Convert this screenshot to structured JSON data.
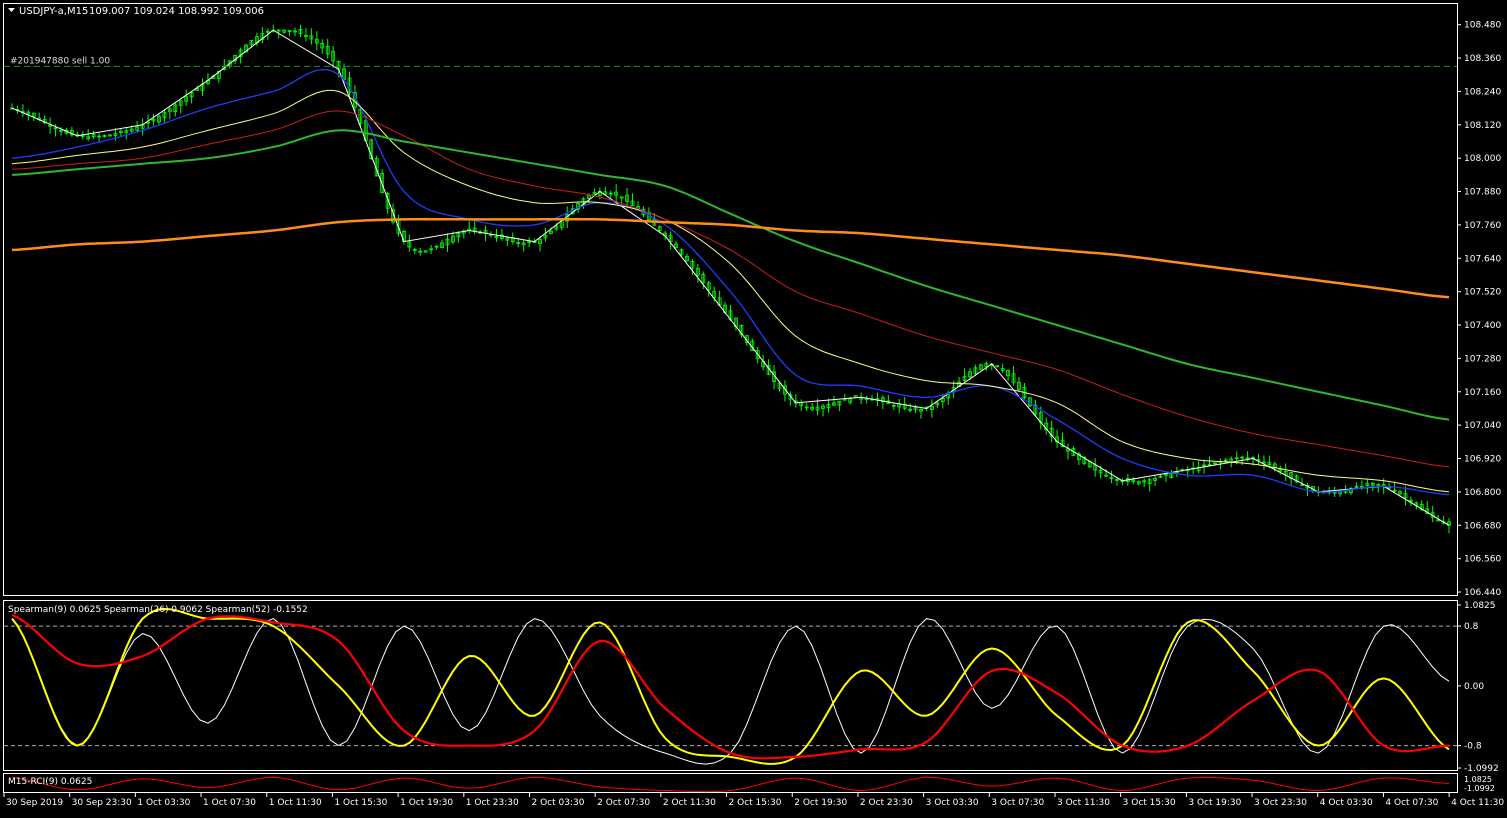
{
  "colors": {
    "background": "#000000",
    "frame": "#ffffff",
    "candle": "#00ff00",
    "zigzag": "#ffffff",
    "ma_blue": "#1e3cff",
    "ma_yellow": "#ffff80",
    "ma_red": "#c81e1e",
    "ma_green": "#2db82d",
    "ma_orange": "#ff8c1a",
    "order_line": "#2e8b2e",
    "spearman_fast": "#ffffff",
    "spearman_mid": "#ffff00",
    "spearman_slow": "#ff0000",
    "rci": "#ff0000"
  },
  "main": {
    "header": {
      "menu_icon": "triangle-down-icon",
      "symbol": "USDJPY-a,M15",
      "ohlc": "109.007 109.024 108.992 109.006"
    },
    "order_label": "#201947880 sell 1.00",
    "order_price": 108.33,
    "price_axis": [
      "108.480",
      "108.360",
      "108.240",
      "108.120",
      "108.000",
      "107.880",
      "107.760",
      "107.640",
      "107.520",
      "107.400",
      "107.280",
      "107.160",
      "107.040",
      "106.920",
      "106.800",
      "106.680",
      "106.560",
      "106.440"
    ]
  },
  "osc": {
    "label": "Spearman(9) 0.0625  Spearman(26) 0.9062  Spearman(52) -0.1552",
    "axis": [
      "1.0825",
      "0.8",
      "0.00",
      "-0.8",
      "-1.0992"
    ]
  },
  "rci": {
    "label": "M15-RCI(9) 0.0625",
    "axis": [
      "1.0825",
      "-1.0992"
    ]
  },
  "time_axis": [
    "30 Sep 2019",
    "30 Sep 23:30",
    "1 Oct 03:30",
    "1 Oct 07:30",
    "1 Oct 11:30",
    "1 Oct 15:30",
    "1 Oct 19:30",
    "1 Oct 23:30",
    "2 Oct 03:30",
    "2 Oct 07:30",
    "2 Oct 11:30",
    "2 Oct 15:30",
    "2 Oct 19:30",
    "2 Oct 23:30",
    "3 Oct 03:30",
    "3 Oct 07:30",
    "3 Oct 11:30",
    "3 Oct 15:30",
    "3 Oct 19:30",
    "3 Oct 23:30",
    "4 Oct 03:30",
    "4 Oct 07:30",
    "4 Oct 11:30"
  ],
  "chart_data": [
    {
      "type": "line",
      "title": "USDJPY-a,M15",
      "ylim": [
        106.44,
        108.54
      ],
      "x": [
        "30 Sep 2019",
        "30 Sep 23:30",
        "1 Oct 03:30",
        "1 Oct 07:30",
        "1 Oct 11:30",
        "1 Oct 15:30",
        "1 Oct 19:30",
        "1 Oct 23:30",
        "2 Oct 03:30",
        "2 Oct 07:30",
        "2 Oct 11:30",
        "2 Oct 15:30",
        "2 Oct 19:30",
        "2 Oct 23:30",
        "3 Oct 03:30",
        "3 Oct 07:30",
        "3 Oct 11:30",
        "3 Oct 15:30",
        "3 Oct 19:30",
        "3 Oct 23:30",
        "4 Oct 03:30",
        "4 Oct 07:30",
        "4 Oct 11:30"
      ],
      "series": [
        {
          "values": [
            108.18,
            108.08,
            108.12,
            108.28,
            108.46,
            108.32,
            107.7,
            107.74,
            107.7,
            107.88,
            107.72,
            107.42,
            107.12,
            107.14,
            107.1,
            107.26,
            106.98,
            106.84,
            106.88,
            106.92,
            106.8,
            106.82,
            106.68
          ]
        },
        {
          "values": [
            108.0,
            108.04,
            108.1,
            108.18,
            108.24,
            108.3,
            107.88,
            107.78,
            107.76,
            107.84,
            107.76,
            107.52,
            107.22,
            107.18,
            107.14,
            107.18,
            107.06,
            106.92,
            106.86,
            106.86,
            106.8,
            106.82,
            106.79
          ]
        },
        {
          "values": [
            107.98,
            108.01,
            108.04,
            108.1,
            108.16,
            108.24,
            108.02,
            107.9,
            107.84,
            107.84,
            107.78,
            107.62,
            107.36,
            107.26,
            107.2,
            107.18,
            107.12,
            106.98,
            106.92,
            106.9,
            106.86,
            106.84,
            106.8
          ]
        },
        {
          "values": [
            107.96,
            107.98,
            108.0,
            108.05,
            108.1,
            108.17,
            108.08,
            107.96,
            107.9,
            107.86,
            107.78,
            107.67,
            107.52,
            107.44,
            107.36,
            107.3,
            107.24,
            107.15,
            107.07,
            107.01,
            106.97,
            106.93,
            106.89
          ]
        },
        {
          "values": [
            107.94,
            107.96,
            107.98,
            108.0,
            108.04,
            108.1,
            108.06,
            108.02,
            107.98,
            107.94,
            107.9,
            107.8,
            107.7,
            107.62,
            107.54,
            107.47,
            107.4,
            107.33,
            107.26,
            107.21,
            107.16,
            107.11,
            107.06
          ]
        },
        {
          "values": [
            107.67,
            107.69,
            107.7,
            107.72,
            107.74,
            107.77,
            107.78,
            107.78,
            107.78,
            107.78,
            107.77,
            107.76,
            107.74,
            107.73,
            107.71,
            107.69,
            107.67,
            107.65,
            107.62,
            107.59,
            107.56,
            107.53,
            107.5
          ]
        }
      ]
    },
    {
      "type": "line",
      "title": "Spearman(9) 0.0625  Spearman(26) 0.9062  Spearman(52) -0.1552",
      "ylim": [
        -1.0992,
        1.0825
      ],
      "x": [
        "30 Sep 2019",
        "30 Sep 23:30",
        "1 Oct 03:30",
        "1 Oct 07:30",
        "1 Oct 11:30",
        "1 Oct 15:30",
        "1 Oct 19:30",
        "1 Oct 23:30",
        "2 Oct 03:30",
        "2 Oct 07:30",
        "2 Oct 11:30",
        "2 Oct 15:30",
        "2 Oct 19:30",
        "2 Oct 23:30",
        "3 Oct 03:30",
        "3 Oct 07:30",
        "3 Oct 11:30",
        "3 Oct 15:30",
        "3 Oct 19:30",
        "3 Oct 23:30",
        "4 Oct 03:30",
        "4 Oct 07:30",
        "4 Oct 11:30"
      ],
      "series": [
        {
          "name": "Spearman(9)",
          "values": [
            0.9,
            -0.8,
            0.7,
            -0.5,
            0.9,
            -0.8,
            0.8,
            -0.6,
            0.9,
            -0.4,
            -0.9,
            -0.9,
            0.8,
            -0.9,
            0.9,
            -0.3,
            0.8,
            -0.9,
            0.8,
            0.5,
            -0.9,
            0.8,
            0.0625
          ]
        },
        {
          "name": "Spearman(26)",
          "values": [
            0.9,
            -0.8,
            0.9,
            0.9,
            0.8,
            0.0,
            -0.8,
            0.4,
            -0.4,
            0.85,
            -0.7,
            -0.95,
            -0.95,
            0.2,
            -0.4,
            0.5,
            -0.4,
            -0.8,
            0.85,
            0.2,
            -0.8,
            0.1,
            -0.85
          ]
        },
        {
          "name": "Spearman(52)",
          "values": [
            0.95,
            0.3,
            0.4,
            0.9,
            0.85,
            0.6,
            -0.6,
            -0.8,
            -0.6,
            0.6,
            -0.3,
            -0.9,
            -0.95,
            -0.85,
            -0.75,
            0.2,
            -0.1,
            -0.8,
            -0.8,
            -0.2,
            0.2,
            -0.8,
            -0.8
          ]
        }
      ]
    },
    {
      "type": "line",
      "title": "M15-RCI(9) 0.0625",
      "ylim": [
        -1.0992,
        1.0825
      ],
      "x": [
        "30 Sep 2019",
        "30 Sep 23:30",
        "1 Oct 03:30",
        "1 Oct 07:30",
        "1 Oct 11:30",
        "1 Oct 15:30",
        "1 Oct 19:30",
        "1 Oct 23:30",
        "2 Oct 03:30",
        "2 Oct 07:30",
        "2 Oct 11:30",
        "2 Oct 15:30",
        "2 Oct 19:30",
        "2 Oct 23:30",
        "3 Oct 03:30",
        "3 Oct 07:30",
        "3 Oct 11:30",
        "3 Oct 15:30",
        "3 Oct 19:30",
        "3 Oct 23:30",
        "4 Oct 03:30",
        "4 Oct 07:30",
        "4 Oct 11:30"
      ],
      "series": [
        {
          "name": "M15-RCI(9)",
          "values": [
            0.9,
            -0.8,
            0.7,
            -0.5,
            0.9,
            -0.8,
            0.8,
            -0.6,
            0.9,
            -0.4,
            -0.9,
            -0.9,
            0.8,
            -0.9,
            0.9,
            -0.3,
            0.8,
            -0.9,
            0.8,
            0.5,
            -0.9,
            0.8,
            0.0625
          ]
        }
      ]
    }
  ]
}
